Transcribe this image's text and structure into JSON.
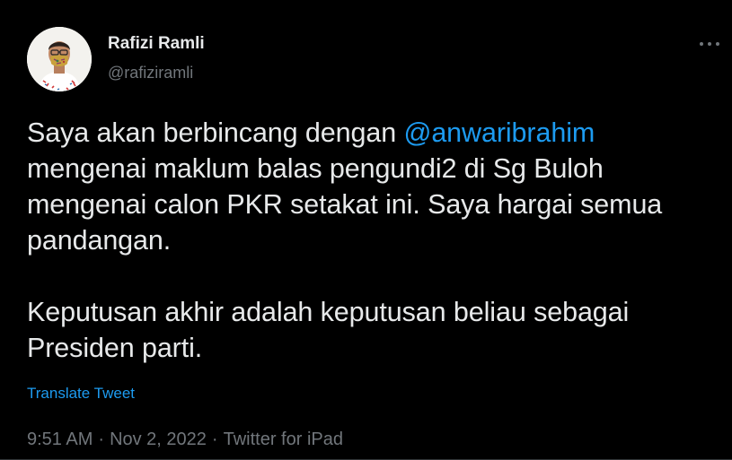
{
  "author": {
    "display_name": "Rafizi Ramli",
    "handle": "@rafiziramli",
    "avatar_icon": "profile-photo"
  },
  "tweet": {
    "paragraph1_before": "Saya akan berbincang dengan ",
    "mention": "@anwaribrahim",
    "paragraph1_after": " mengenai maklum balas pengundi2 di Sg Buloh mengenai calon PKR setakat ini. Saya hargai semua pandangan.",
    "paragraph2": "Keputusan akhir adalah keputusan beliau sebagai Presiden parti."
  },
  "translate_label": "Translate Tweet",
  "meta": {
    "time": "9:51 AM",
    "separator": "·",
    "date": "Nov 2, 2022",
    "source": "Twitter for iPad"
  },
  "more_icon": "more-horizontal-icon",
  "colors": {
    "background": "#000000",
    "text": "#e7e9ea",
    "secondary": "#71767b",
    "link": "#1d9bf0"
  }
}
